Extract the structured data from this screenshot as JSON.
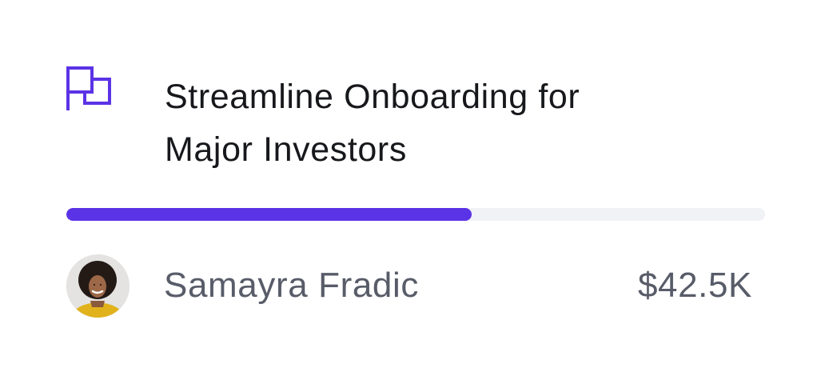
{
  "card": {
    "icon": "flag-icon",
    "title_line1": "Streamline Onboarding for",
    "title_line2": "Major Investors",
    "progress_fraction": 0.58,
    "owner": {
      "name": "Samayra Fradic",
      "avatar": "avatar-photo"
    },
    "amount": "$42.5K"
  },
  "colors": {
    "accent": "#5b33e6",
    "track": "#f1f2f6",
    "title_text": "#17181c",
    "secondary_text": "#585c69"
  }
}
